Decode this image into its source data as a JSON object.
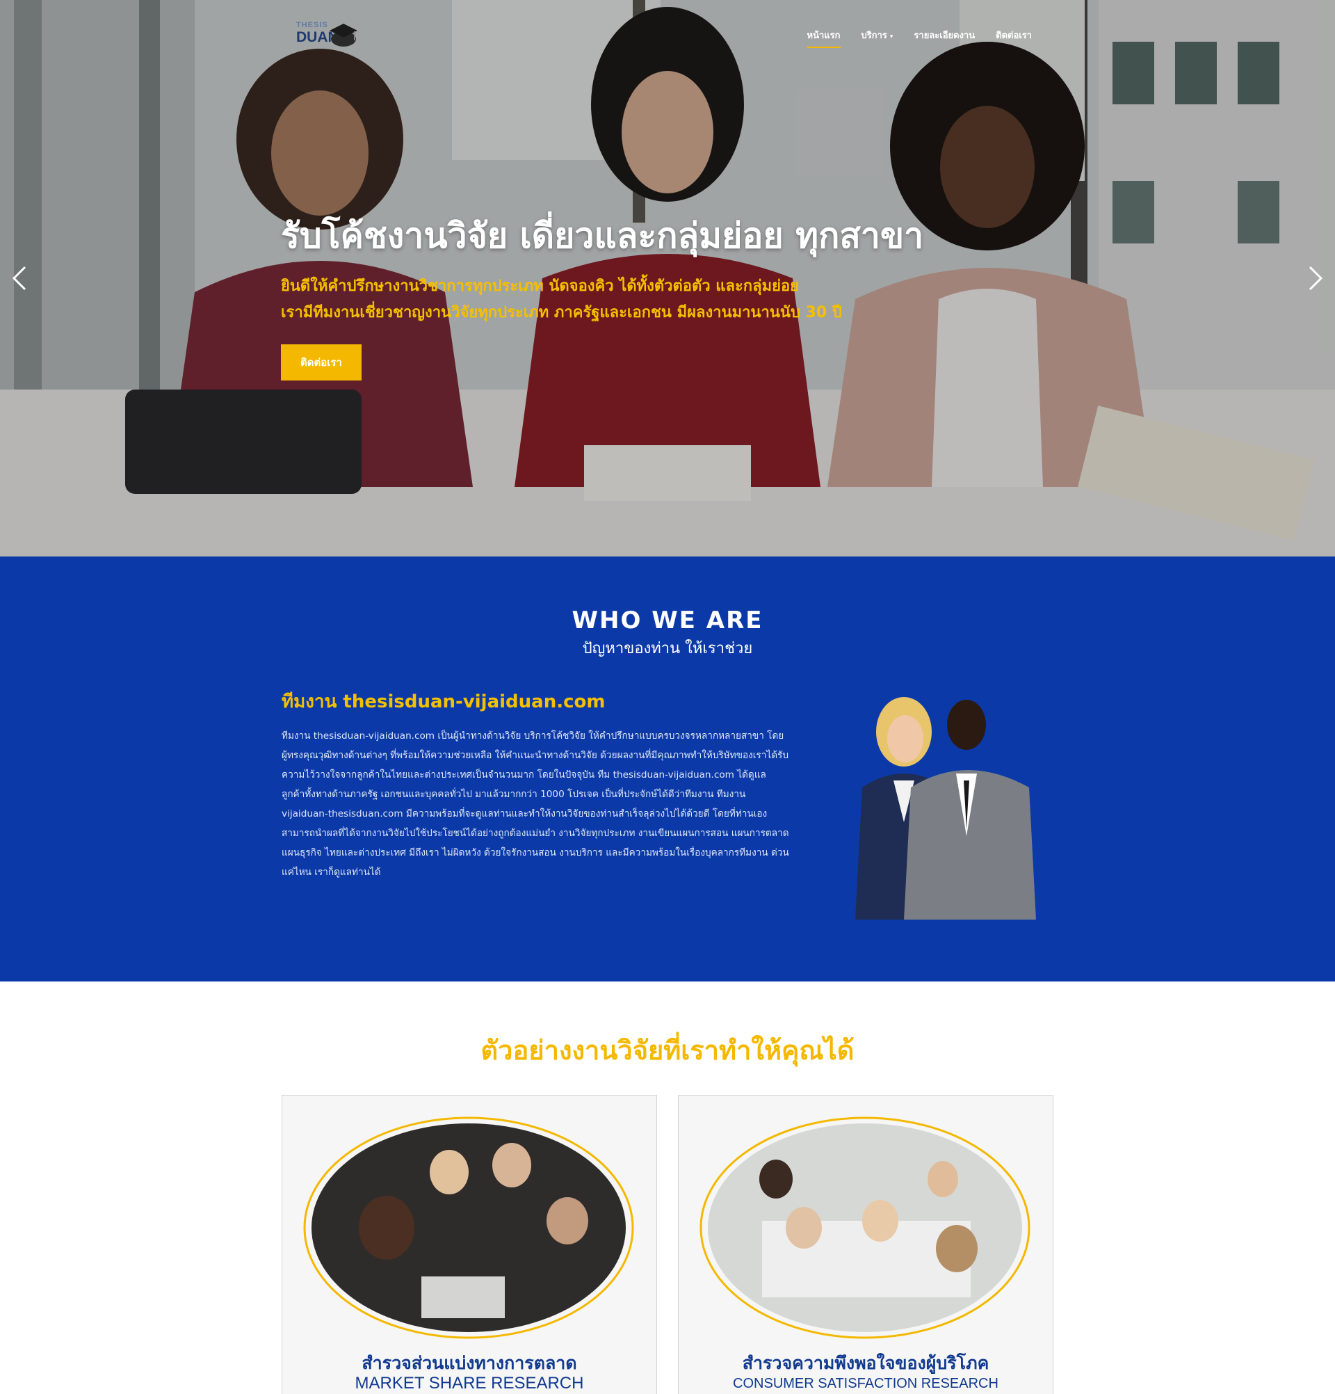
{
  "nav": {
    "logo_top": "THESIS",
    "logo_main": "DUAN",
    "items": [
      {
        "label": "หน้าแรก",
        "active": true
      },
      {
        "label": "บริการ",
        "has_dropdown": true
      },
      {
        "label": "รายละเอียดงาน"
      },
      {
        "label": "ติดต่อเรา"
      }
    ]
  },
  "hero": {
    "title": "รับโค้ชงานวิจัย เดี่ยวและกลุ่มย่อย ทุกสาขา",
    "subtitle_line1": "ยินดีให้คำปรึกษางานวิชาการทุกประเภท นัดจองคิว ได้ทั้งตัวต่อตัว และกลุ่มย่อย",
    "subtitle_line2": "เรามีทีมงานเชี่ยวชาญงานวิจัยทุกประเภท ภาครัฐและเอกชน มีผลงานมานานนับ 30 ปี",
    "button_label": "ติดต่อเรา"
  },
  "who": {
    "title": "WHO WE ARE",
    "subtitle": "ปัญหาของท่าน ให้เราช่วย",
    "team_heading": "ทีมงาน thesisduan-vijaiduan.com",
    "body": "ทีมงาน thesisduan-vijaiduan.com เป็นผู้นำทางด้านวิจัย บริการโค้ชวิจัย ให้คำปรึกษาแบบครบวงจรหลากหลายสาขา โดยผู้ทรงคุณวุฒิทางด้านต่างๆ ที่พร้อมให้ความช่วยเหลือ ให้คำแนะนำทางด้านวิจัย ด้วยผลงานที่มีคุณภาพทำให้บริษัทของเราได้รับความไว้วางใจจากลูกค้าในไทยและต่างประเทศเป็นจำนวนมาก โดยในปัจจุบัน ทีม thesisduan-vijaiduan.com ได้ดูแลลูกค้าทั้งทางด้านภาครัฐ เอกชนและบุคคลทั่วไป มาแล้วมากกว่า 1000 โปรเจค เป็นที่ประจักษ์ได้ดีว่าทีมงาน ทีมงาน vijaiduan-thesisduan.com มีความพร้อมที่จะดูแลท่านและทำให้งานวิจัยของท่านสำเร็จลุล่วงไปได้ด้วยดี โดยที่ท่านเองสามารถนำผลที่ได้จากงานวิจัยไปใช้ประโยชน์ได้อย่างถูกต้องแม่นยำ งานวิจัยทุกประเภท งานเขียนแผนการสอน แผนการตลาด แผนธุรกิจ ไทยและต่างประเทศ มีถึงเรา ไม่ผิดหวัง ด้วยใจรักงานสอน งานบริการ และมีความพร้อมในเรื่องบุคลากรทีมงาน ด่วนแค่ไหน เราก็ดูแลท่านได้"
  },
  "examples": {
    "title": "ตัวอย่างงานวิจัยที่เราทำให้คุณได้",
    "cards": [
      {
        "title_th": "สำรวจส่วนแบ่งทางการตลาด",
        "title_en": "MARKET SHARE RESEARCH"
      },
      {
        "title_th": "สำรวจความพึงพอใจของผู้บริโภค",
        "title_en": "CONSUMER SATISFACTION RESEARCH"
      }
    ]
  },
  "colors": {
    "accent_yellow": "#f5b800",
    "brand_blue": "#0b3aa8",
    "card_title_blue": "#123a8f"
  }
}
